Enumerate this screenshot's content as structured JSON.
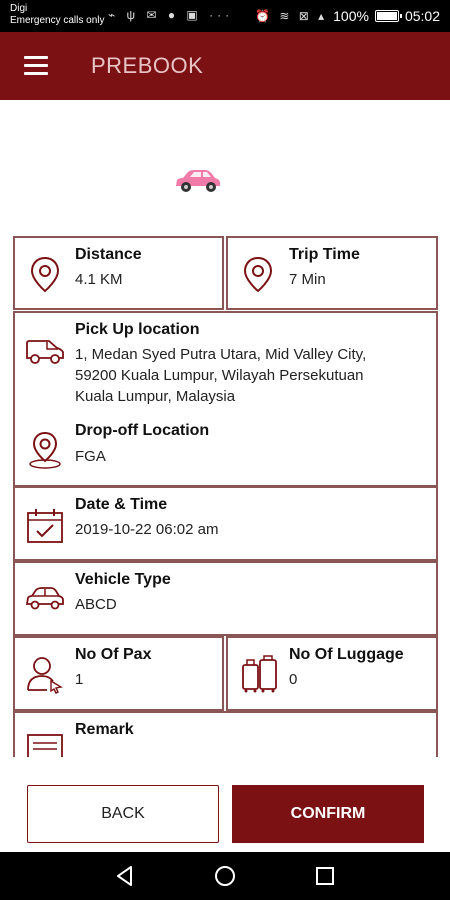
{
  "status_bar": {
    "carrier": "Digi",
    "emergency": "Emergency calls only",
    "battery": "100%",
    "time": "05:02"
  },
  "header": {
    "title": "PREBOOK"
  },
  "trip": {
    "distance_label": "Distance",
    "distance_value": "4.1 KM",
    "trip_time_label": "Trip Time",
    "trip_time_value": "7 Min"
  },
  "locations": {
    "pickup_label": "Pick Up location",
    "pickup_line1": "1, Medan Syed Putra Utara, Mid Valley City,",
    "pickup_line2": "59200 Kuala Lumpur, Wilayah Persekutuan",
    "pickup_line3": "Kuala Lumpur, Malaysia",
    "dropoff_label": "Drop-off Location",
    "dropoff_value": "FGA"
  },
  "datetime": {
    "label": "Date & Time",
    "value": "2019-10-22 06:02 am"
  },
  "vehicle": {
    "label": "Vehicle Type",
    "value": "ABCD"
  },
  "pax": {
    "label": "No Of Pax",
    "value": "1"
  },
  "luggage": {
    "label": "No Of Luggage",
    "value": "0"
  },
  "remark": {
    "label": "Remark"
  },
  "buttons": {
    "back": "BACK",
    "confirm": "CONFIRM"
  },
  "colors": {
    "brand": "#7b1113",
    "card_border": "#8a5656",
    "car_pink": "#f07aa8"
  }
}
